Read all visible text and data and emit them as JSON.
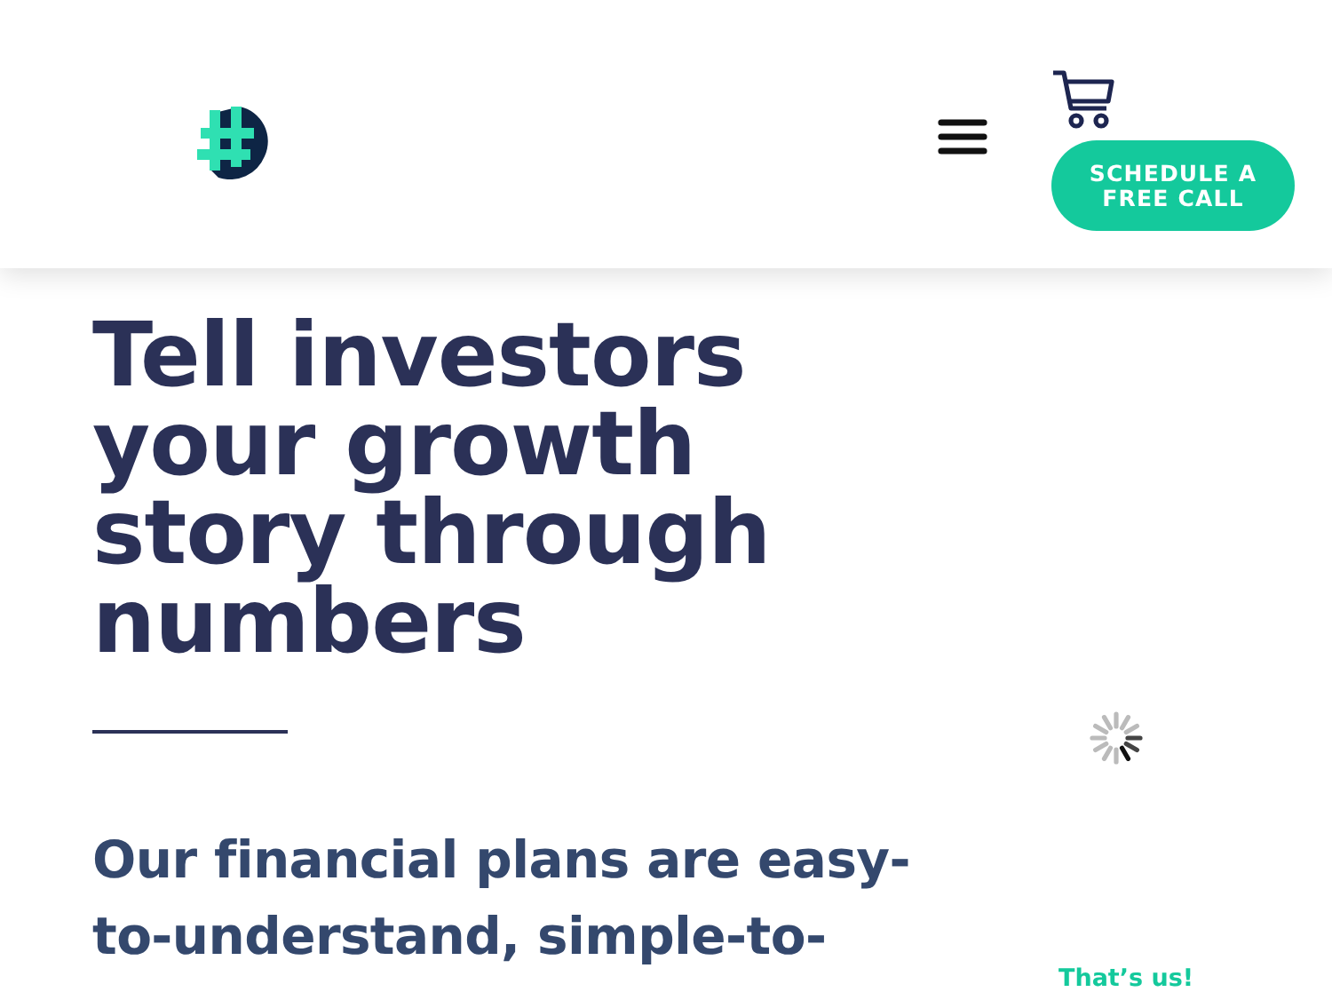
{
  "header": {
    "cta_button": "SCHEDULE A FREE CALL"
  },
  "hero": {
    "headline_lines": [
      "Tell investors",
      "your growth",
      "story through",
      "numbers"
    ],
    "subtitle_lines": [
      "Our financial plans are easy-",
      "to-understand, simple-to-"
    ]
  },
  "caption": "That’s us!"
}
